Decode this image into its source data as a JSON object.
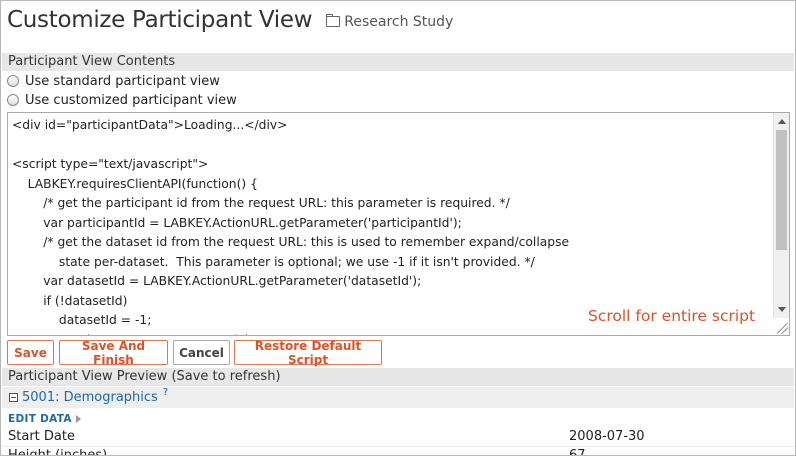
{
  "header": {
    "title": "Customize Participant View",
    "folder": "Research Study"
  },
  "contents_section": {
    "heading": "Participant View Contents",
    "options": [
      {
        "label": "Use standard participant view",
        "selected": false
      },
      {
        "label": "Use customized participant view",
        "selected": false
      }
    ]
  },
  "editor": {
    "lines": [
      "<div id=\"participantData\">Loading...</div>",
      "",
      "<script type=\"text/javascript\">",
      "    LABKEY.requiresClientAPI(function() {",
      "        /* get the participant id from the request URL: this parameter is required. */",
      "        var participantId = LABKEY.ActionURL.getParameter('participantId');",
      "        /* get the dataset id from the request URL: this is used to remember expand/collapse",
      "            state per-dataset.  This parameter is optional; we use -1 if it isn't provided. */",
      "        var datasetId = LABKEY.ActionURL.getParameter('datasetId');",
      "        if (!datasetId)",
      "            datasetId = -1;",
      "            var dataType = 'ALL';  ...participant"
    ]
  },
  "annotation": "Scroll for entire script",
  "buttons": {
    "save": "Save",
    "save_and_finish": "Save And Finish",
    "cancel": "Cancel",
    "restore": "Restore Default Script"
  },
  "preview": {
    "heading": "Participant View Preview (Save to refresh)",
    "dataset_link": "5001: Demographics",
    "help_mark": "?",
    "edit_data": "EDIT DATA",
    "rows": [
      {
        "label": "Start Date",
        "value": "2008-07-30"
      },
      {
        "label": "Height (inches)",
        "value": "67"
      }
    ]
  },
  "colors": {
    "accent": "#d9542b",
    "link": "#1f6aa5",
    "section_bg": "#e7e7e7"
  }
}
